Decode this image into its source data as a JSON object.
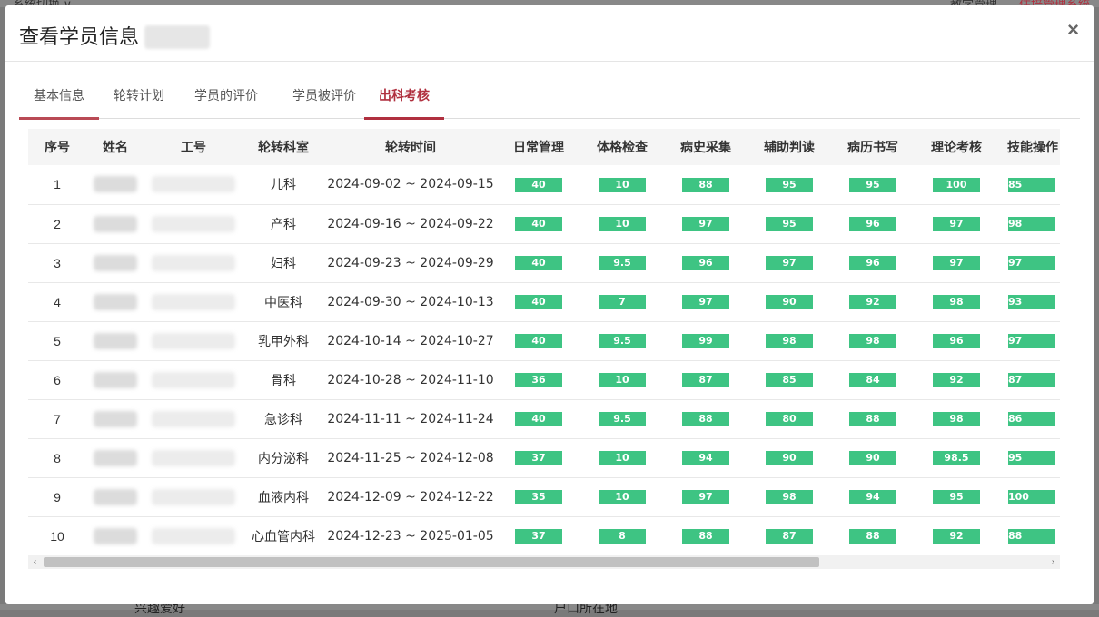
{
  "modal": {
    "title": "查看学员信息",
    "close_label": "×"
  },
  "tabs": [
    {
      "label": "基本信息"
    },
    {
      "label": "轮转计划"
    },
    {
      "label": "学员的评价"
    },
    {
      "label": "学员被评价"
    },
    {
      "label": "出科考核",
      "active": true
    }
  ],
  "table": {
    "columns": [
      "序号",
      "姓名",
      "工号",
      "轮转科室",
      "轮转时间",
      "日常管理",
      "体格检查",
      "病史采集",
      "辅助判读",
      "病历书写",
      "理论考核",
      "技能操作"
    ],
    "rows": [
      {
        "no": "1",
        "dept": "儿科",
        "time": "2024-09-02 ~ 2024-09-15",
        "scores": [
          "40",
          "10",
          "88",
          "95",
          "95",
          "100",
          "85"
        ]
      },
      {
        "no": "2",
        "dept": "产科",
        "time": "2024-09-16 ~ 2024-09-22",
        "scores": [
          "40",
          "10",
          "97",
          "95",
          "96",
          "97",
          "98"
        ]
      },
      {
        "no": "3",
        "dept": "妇科",
        "time": "2024-09-23 ~ 2024-09-29",
        "scores": [
          "40",
          "9.5",
          "96",
          "97",
          "96",
          "97",
          "97"
        ]
      },
      {
        "no": "4",
        "dept": "中医科",
        "time": "2024-09-30 ~ 2024-10-13",
        "scores": [
          "40",
          "7",
          "97",
          "90",
          "92",
          "98",
          "93"
        ]
      },
      {
        "no": "5",
        "dept": "乳甲外科",
        "time": "2024-10-14 ~ 2024-10-27",
        "scores": [
          "40",
          "9.5",
          "99",
          "98",
          "98",
          "96",
          "97"
        ]
      },
      {
        "no": "6",
        "dept": "骨科",
        "time": "2024-10-28 ~ 2024-11-10",
        "scores": [
          "36",
          "10",
          "87",
          "85",
          "84",
          "92",
          "87"
        ]
      },
      {
        "no": "7",
        "dept": "急诊科",
        "time": "2024-11-11 ~ 2024-11-24",
        "scores": [
          "40",
          "9.5",
          "88",
          "80",
          "88",
          "98",
          "86"
        ]
      },
      {
        "no": "8",
        "dept": "内分泌科",
        "time": "2024-11-25 ~ 2024-12-08",
        "scores": [
          "37",
          "10",
          "94",
          "90",
          "90",
          "98.5",
          "95"
        ]
      },
      {
        "no": "9",
        "dept": "血液内科",
        "time": "2024-12-09 ~ 2024-12-22",
        "scores": [
          "35",
          "10",
          "97",
          "98",
          "94",
          "95",
          "100"
        ]
      },
      {
        "no": "10",
        "dept": "心血管内科",
        "time": "2024-12-23 ~ 2025-01-05",
        "scores": [
          "37",
          "8",
          "88",
          "87",
          "88",
          "92",
          "88"
        ]
      }
    ]
  },
  "scrollbar": {
    "left_arrow": "‹",
    "right_arrow": "›"
  },
  "colors": {
    "accent": "#b0303f",
    "score_badge": "#3ec483"
  },
  "background": {
    "top_left_text": "系统切换 ∨",
    "top_right_text_1": "教学管理",
    "top_right_text_2": "住培管理系统",
    "bottom_left_text": "兴趣爱好",
    "bottom_right_text": "户口所在地"
  }
}
